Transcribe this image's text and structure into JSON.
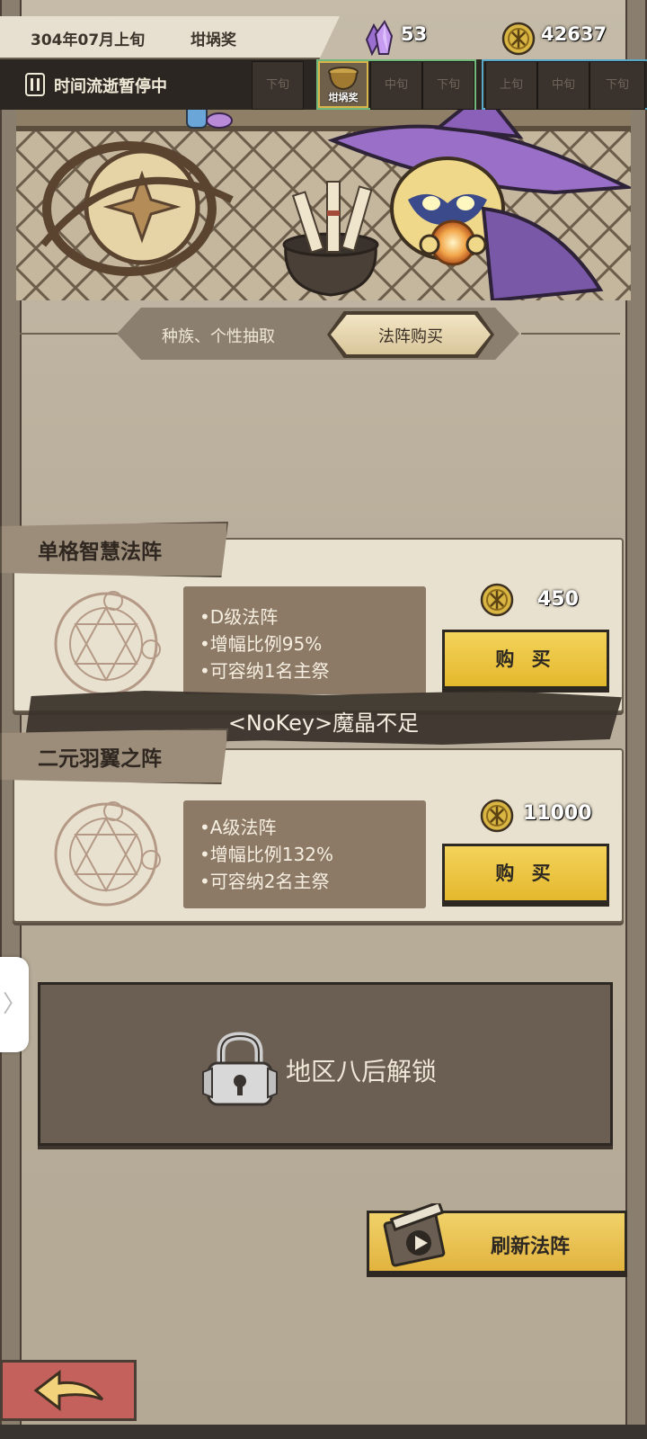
{
  "header": {
    "date": "304年07月上旬",
    "award": "坩埚奖",
    "crystals": "53",
    "gold": "42637"
  },
  "time_bar": {
    "status": "时间流逝暂停中",
    "slots": [
      {
        "label": "下旬"
      },
      {
        "label": "坩埚奖",
        "current": true
      },
      {
        "label": "中旬"
      },
      {
        "label": "下旬"
      },
      {
        "label": "上旬"
      },
      {
        "label": "中旬"
      },
      {
        "label": "下旬"
      }
    ]
  },
  "tabs": [
    {
      "label": "种族、个性抽取",
      "active": false
    },
    {
      "label": "法阵购买",
      "active": true
    }
  ],
  "arrays": [
    {
      "name": "单格智慧法阵",
      "stats": [
        "•D级法阵",
        "•增幅比例95%",
        "•可容纳1名主祭"
      ],
      "price": "450",
      "buy_label": "购 买"
    },
    {
      "name": "二元羽翼之阵",
      "stats": [
        "•A级法阵",
        "•增幅比例132%",
        "•可容纳2名主祭"
      ],
      "price": "11000",
      "buy_label": "购 买"
    }
  ],
  "toast": "<NoKey>魔晶不足",
  "locked_slot": {
    "text": "地区八后解锁"
  },
  "refresh_label": "刷新法阵",
  "side_handle": "〉",
  "colors": {
    "buy_button": "#e9c23e",
    "toast_bg": "#3a332c",
    "back_button": "#c4615d",
    "time_slot_green_border": "#6fb87a",
    "time_slot_blue_border": "#5aa8c8"
  }
}
